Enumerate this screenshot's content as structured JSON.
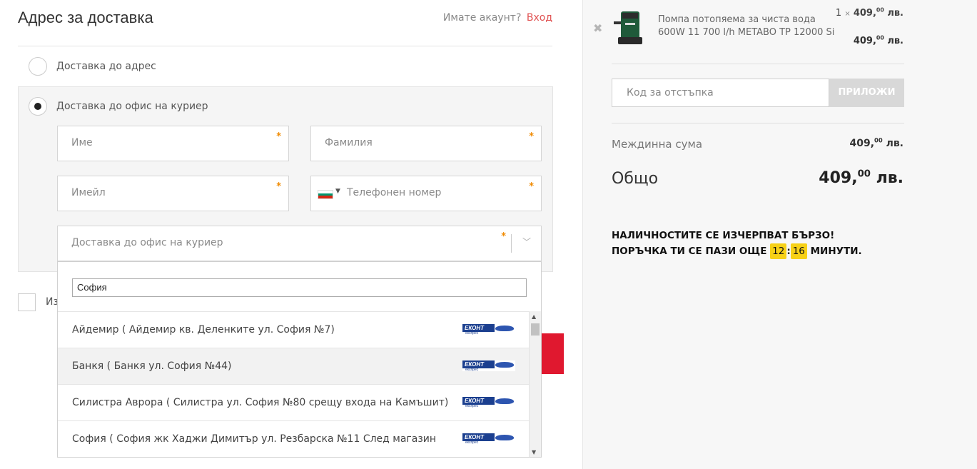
{
  "header": {
    "title": "Адрес за доставка",
    "account_question": "Имате акаунт?",
    "login_link": "Вход"
  },
  "shipping": {
    "option_address": "Доставка до адрес",
    "option_office": "Доставка до офис на куриер",
    "selected": "office"
  },
  "form": {
    "first_name_placeholder": "Име",
    "last_name_placeholder": "Фамилия",
    "email_placeholder": "Имейл",
    "phone_placeholder": "Телефонен номер",
    "office_select_placeholder": "Доставка до офис на куриер",
    "required_mark": "*",
    "phone_country_flag_colors": [
      "#ffffff",
      "#00966e",
      "#d62612"
    ]
  },
  "checkbox": {
    "label_visible": "Из"
  },
  "dropdown": {
    "search_value": "София",
    "items": [
      {
        "text": "Айдемир ( Айдемир кв. Деленките ул. София №7)",
        "courier": "ЕКОНТ"
      },
      {
        "text": "Банкя ( Банкя ул. София №44)",
        "courier": "ЕКОНТ"
      },
      {
        "text": "Силистра Аврора ( Силистра ул. София №80 срещу входа на Камъшит)",
        "courier": "ЕКОНТ"
      },
      {
        "text": "София ( София жк Хаджи Димитър ул. Резбарска №11 След магазин",
        "courier": "ЕКОНТ"
      }
    ],
    "courier_subtitle": "експрес",
    "highlighted_index": 1
  },
  "cart": {
    "product_name": "Помпа потопяема за чиста вода 600W 11 700 l/h METABO TP 12000 Si",
    "quantity": "1",
    "times": "×",
    "unit_price_main": "409,",
    "unit_price_cents": "00",
    "currency": "лв.",
    "line_total_main": "409,",
    "line_total_cents": "00"
  },
  "coupon": {
    "placeholder": "Код за отстъпка",
    "apply_label": "ПРИЛОЖИ"
  },
  "summary": {
    "subtotal_label": "Междинна сума",
    "subtotal_main": "409,",
    "subtotal_cents": "00",
    "total_label": "Общо",
    "total_main": "409,",
    "total_cents": "00"
  },
  "urgency": {
    "line1": "НАЛИЧНОСТИТЕ СЕ ИЗЧЕРПВАТ БЪРЗО!",
    "line2_prefix": "ПОРЪЧКА ТИ СЕ ПАЗИ ОЩЕ",
    "minutes": "12",
    "separator": ":",
    "seconds": "16",
    "line2_suffix": "МИНУТИ.",
    "highlight_color": "#f7d117"
  },
  "colors": {
    "accent_red": "#e0182f",
    "link_red": "#e05252",
    "required_orange": "#f08a00",
    "courier_blue": "#1b3f8f"
  }
}
